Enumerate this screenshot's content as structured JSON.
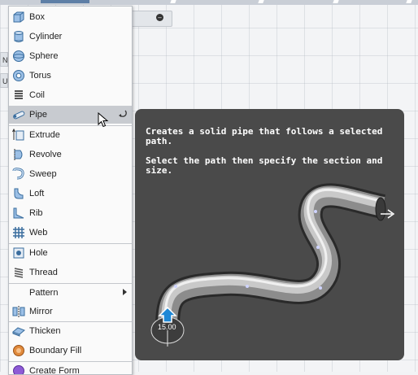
{
  "menu": {
    "items": [
      {
        "label": "Box",
        "icon": "box-icon"
      },
      {
        "label": "Cylinder",
        "icon": "cylinder-icon"
      },
      {
        "label": "Sphere",
        "icon": "sphere-icon"
      },
      {
        "label": "Torus",
        "icon": "torus-icon"
      },
      {
        "label": "Coil",
        "icon": "coil-icon"
      },
      {
        "label": "Pipe",
        "icon": "pipe-icon",
        "highlighted": true
      },
      {
        "label": "Extrude",
        "icon": "extrude-icon"
      },
      {
        "label": "Revolve",
        "icon": "revolve-icon"
      },
      {
        "label": "Sweep",
        "icon": "sweep-icon"
      },
      {
        "label": "Loft",
        "icon": "loft-icon"
      },
      {
        "label": "Rib",
        "icon": "rib-icon"
      },
      {
        "label": "Web",
        "icon": "web-icon"
      },
      {
        "label": "Hole",
        "icon": "hole-icon"
      },
      {
        "label": "Thread",
        "icon": "thread-icon"
      },
      {
        "label": "Pattern",
        "icon": "",
        "submenu": true
      },
      {
        "label": "Mirror",
        "icon": "mirror-icon"
      },
      {
        "label": "Thicken",
        "icon": "thicken-icon"
      },
      {
        "label": "Boundary Fill",
        "icon": "boundary-fill-icon"
      },
      {
        "label": "Create Form",
        "icon": "create-form-icon"
      }
    ]
  },
  "tooltip": {
    "line1": "Creates a solid pipe that follows a selected path.",
    "line2": "Select the path then specify the section and size.",
    "dimension_value": "15.00"
  },
  "left_edge": {
    "n_label": "N",
    "u_label": "U"
  },
  "colors": {
    "highlight": "#c8cbd0",
    "tooltip_bg": "#4a4a4a",
    "accent": "#1e88d6"
  }
}
